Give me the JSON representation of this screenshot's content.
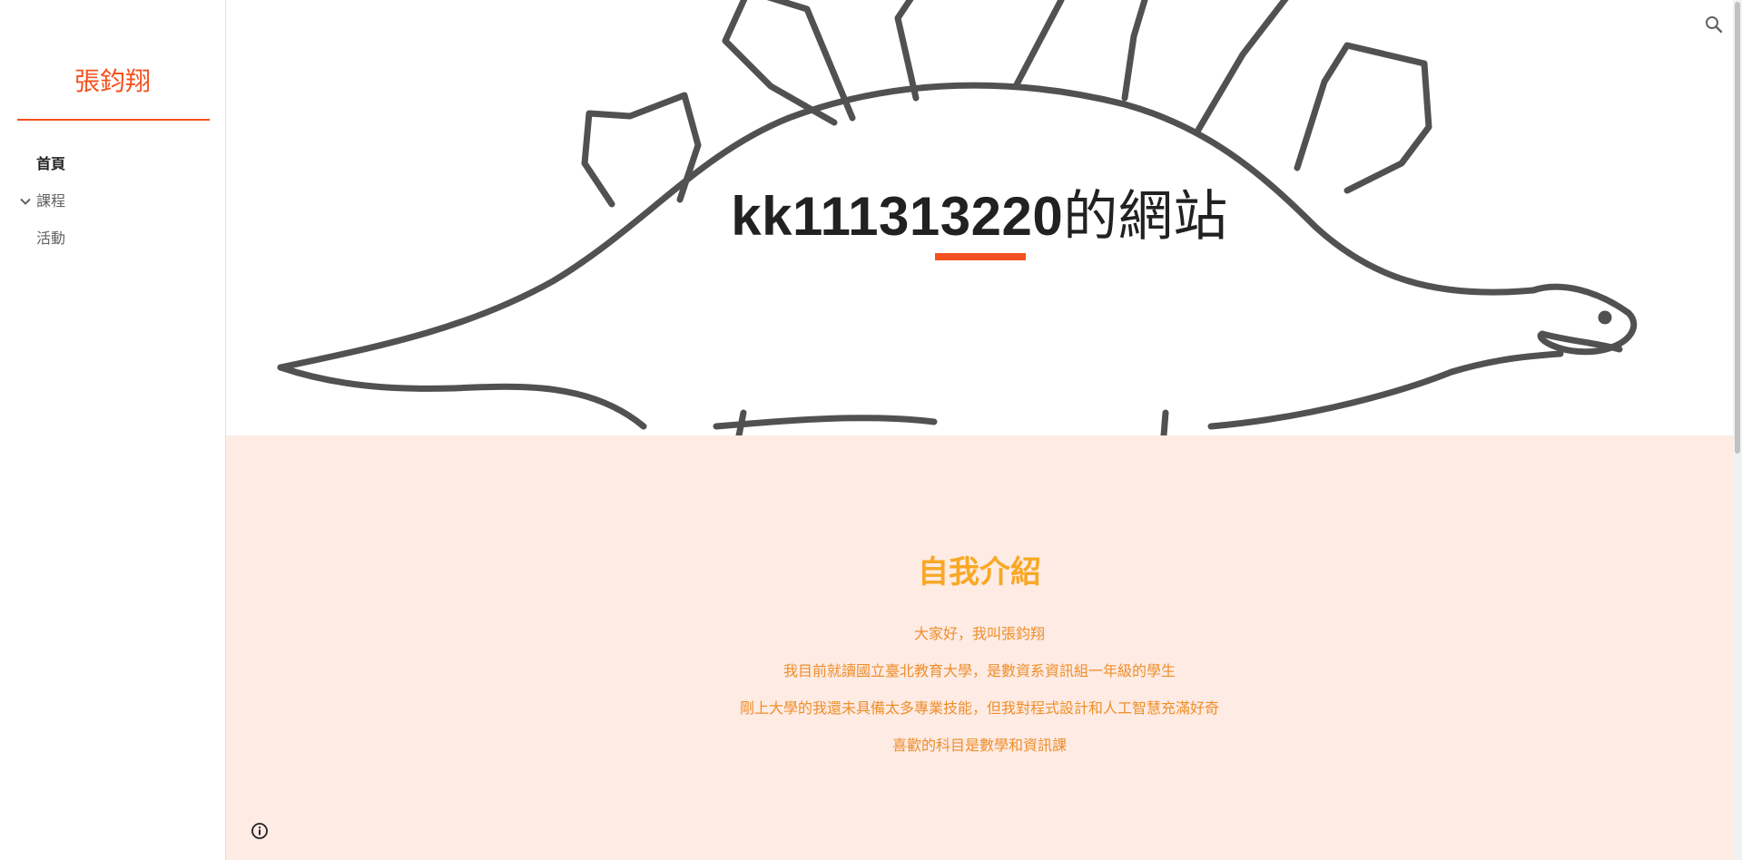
{
  "sidebar": {
    "site_title": "張鈞翔",
    "items": [
      {
        "label": "首頁",
        "active": true
      },
      {
        "label": "課程",
        "expandable": true,
        "icon": "chevron-down-icon"
      },
      {
        "label": "活動"
      }
    ]
  },
  "hero": {
    "title_prefix": "kk111313220",
    "title_suffix": "的網站",
    "accent_color": "#f4511e"
  },
  "intro": {
    "heading": "自我介紹",
    "lines": [
      "大家好，我叫張鈞翔",
      "我目前就讀國立臺北教育大學，是數資系資訊組一年級的學生",
      "剛上大學的我還未具備太多專業技能，但我對程式設計和人工智慧充滿好奇",
      "喜歡的科目是數學和資訊課"
    ],
    "heading_color": "#f9a825",
    "text_color": "#ef8e2a",
    "background": "#fdebe4"
  },
  "icons": {
    "search": "search-icon",
    "info": "info-icon"
  }
}
